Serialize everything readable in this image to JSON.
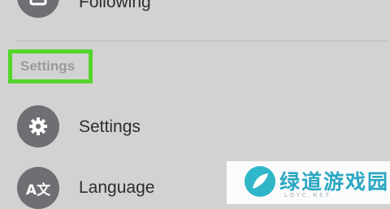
{
  "menu": {
    "following_label": "Following",
    "section_header": "Settings",
    "settings_label": "Settings",
    "language_label": "Language",
    "language_icon_text": "A文"
  },
  "icons": {
    "following": "list-icon",
    "settings": "gear-icon",
    "language": "translate-icon"
  },
  "colors": {
    "background": "#d2d2d2",
    "icon_circle": "#6f6f73",
    "highlight": "#54d62c",
    "section_text": "#9a9a9a",
    "item_text": "#2d2d2d",
    "watermark_accent": "#2aa7c2"
  },
  "watermark": {
    "title": "绿道游戏园",
    "subtitle": "LDYC.NET"
  }
}
